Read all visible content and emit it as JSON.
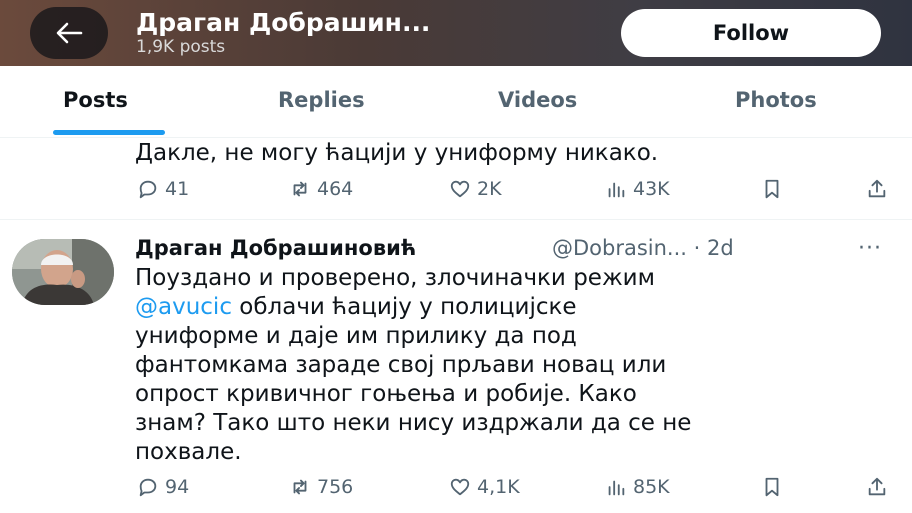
{
  "header": {
    "title": "Драган Добрашин...",
    "posts_count": "1,9K posts",
    "follow_label": "Follow",
    "back_icon": "arrow-left-icon"
  },
  "tabs": [
    {
      "label": "Posts",
      "active": true
    },
    {
      "label": "Replies",
      "active": false
    },
    {
      "label": "Videos",
      "active": false
    },
    {
      "label": "Photos",
      "active": false
    }
  ],
  "tweet1": {
    "text": "Дакле, не могу ћацији у униформу никако.",
    "replies": "41",
    "reposts": "464",
    "likes": "2K",
    "views": "43K"
  },
  "tweet2": {
    "name": "Драган Добрашиновић",
    "handle": "@Dobrasin...",
    "time": "· 2d",
    "more": "···",
    "body_lines": {
      "l1": "Поуздано и проверено, злочиначки режим",
      "mention": "@avucic",
      "l2_rest": " облачи ћацију у полицијске",
      "l3": "униформе и даје им прилику да под",
      "l4": "фантомкама зараде свој прљави новац или",
      "l5": "опрост кривичног гоњења и робије. Како",
      "l6": "знам? Тако што неки нису издржали да се не",
      "l7": "похвале."
    },
    "replies": "94",
    "reposts": "756",
    "likes": "4,1K",
    "views": "85K"
  },
  "colors": {
    "accent": "#1d9bf0",
    "secondary_text": "#536471",
    "primary_text": "#0f1419"
  }
}
